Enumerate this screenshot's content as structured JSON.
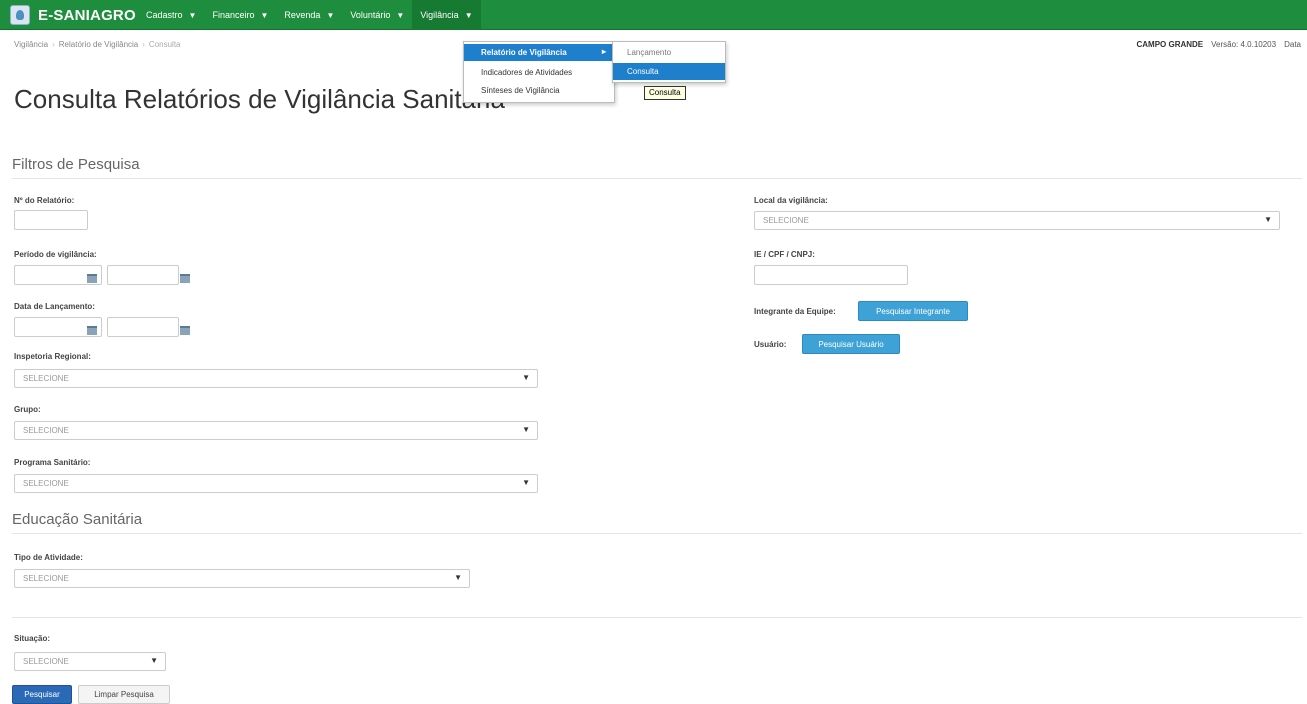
{
  "navbar": {
    "brand": "E-SANIAGRO",
    "items": [
      {
        "label": "Cadastro"
      },
      {
        "label": "Financeiro"
      },
      {
        "label": "Revenda"
      },
      {
        "label": "Voluntário"
      },
      {
        "label": "Vigilância"
      }
    ],
    "active_color": "#167a33",
    "bg_color": "#1e8e3e"
  },
  "breadcrumb": [
    "Vigilância",
    "Relatório de Vigilância",
    "Consulta"
  ],
  "status": {
    "city": "CAMPO GRANDE",
    "version": "Versão: 4.0.10203",
    "date": "Data"
  },
  "page_title": "Consulta Relatórios de Vigilância Sanitária",
  "filters": {
    "section_title": "Filtros de Pesquisa",
    "numero_label": "Nº do Relatório:",
    "periodo_label": "Período de vigilância:",
    "lancamento_label": "Data de Lançamento:",
    "inspetoria_label": "Inspetoria Regional:",
    "inspetoria_value": "SELECIONE",
    "grupo_label": "Grupo:",
    "grupo_value": "SELECIONE",
    "programa_label": "Programa Sanitário:",
    "programa_value": "SELECIONE",
    "local_label": "Local da vigilância:",
    "local_value": "SELECIONE",
    "doc_label": "IE / CPF / CNPJ:",
    "integrante_label": "Integrante da Equipe:",
    "integrante_button": "Pesquisar Integrante",
    "usuario_label": "Usuário:",
    "usuario_button": "Pesquisar Usuário"
  },
  "educacao": {
    "section_title": "Educação Sanitária",
    "tipo_label": "Tipo de Atividade:",
    "tipo_value": "SELECIONE"
  },
  "situacao": {
    "label": "Situação:",
    "value": "SELECIONE"
  },
  "actions": {
    "search": "Pesquisar",
    "clear": "Limpar Pesquisa"
  },
  "menu": {
    "items": [
      "Relatório de Vigilância",
      "Indicadores de Atividades",
      "Sínteses de Vigilância"
    ],
    "submenu": [
      "Lançamento",
      "Consulta"
    ],
    "tooltip": "Consulta"
  }
}
